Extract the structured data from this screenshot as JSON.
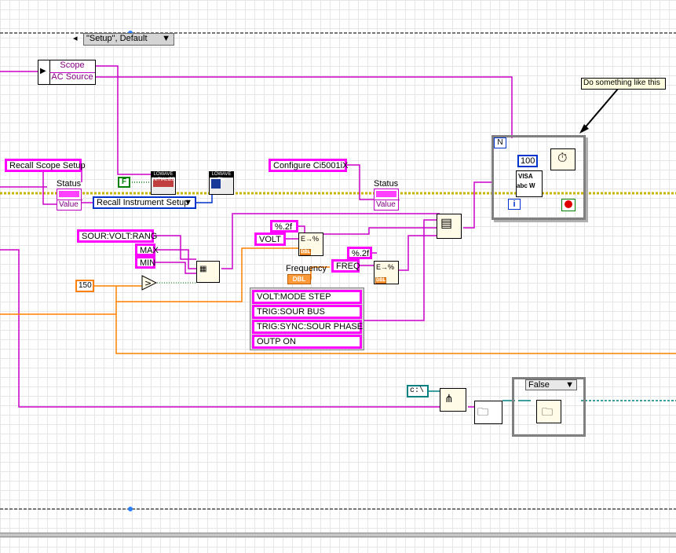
{
  "case_selector": {
    "value": "\"Setup\", Default"
  },
  "cluster_scope": {
    "items": [
      "Scope",
      "AC Source"
    ]
  },
  "annotation": {
    "text": "Do something like this"
  },
  "strings": {
    "recall_scope": "Recall Scope Setup",
    "configure": "Configure Ci5001iX",
    "sour_volt_rang": "SOUR:VOLT:RANG",
    "max": "MAX",
    "min": "MIN",
    "fmt1": "%.2f",
    "volt": "VOLT",
    "fmt2": "%.2f",
    "freq": "FREQ",
    "volt_mode": "VOLT:MODE STEP",
    "trig_sour": "TRIG:SOUR BUS",
    "trig_sync": "TRIG:SYNC:SOUR PHASE",
    "outp_on": "OUTP ON"
  },
  "labels": {
    "status1": "Status",
    "status2": "Status",
    "value1": "Value",
    "value2": "Value",
    "frequency": "Frequency"
  },
  "enum_recall": {
    "value": "Recall Instrument Setup"
  },
  "constants": {
    "false_const": "F",
    "num_150": "150",
    "num_100": "100",
    "path": "c:\\",
    "no_tag": "N",
    "i_tag": "i"
  },
  "case_false": {
    "value": "False"
  },
  "icons": {
    "lowave_init": "LOWAVE INITIALIZE",
    "lowave_file": "LOWAVE File",
    "visa_write": "VISA abc W",
    "wait_ms": "stopwatch-icon",
    "stop": "stop-icon",
    "dbl": "DBL"
  },
  "colors": {
    "string_wire": "#cc00cc",
    "numeric_wire": "#ff8000",
    "error_wire": "#c8b400",
    "path_wire": "#008080",
    "enum_wire": "#0033cc"
  }
}
